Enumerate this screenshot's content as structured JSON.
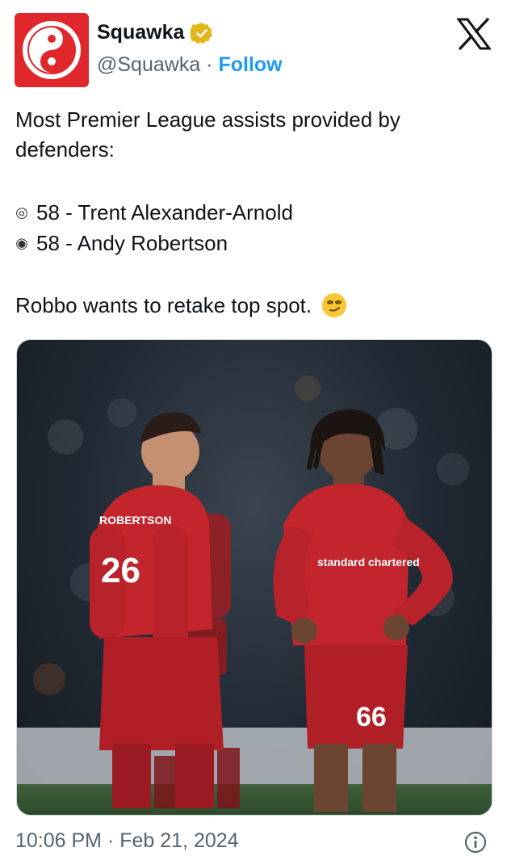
{
  "author": {
    "name": "Squawka",
    "handle": "@Squawka",
    "separator": "·",
    "follow_label": "Follow",
    "brand_color": "#e0272b",
    "verified_badge_color": "#e2b719"
  },
  "tweet": {
    "line1": "Most Premier League assists provided by",
    "line2": "defenders:",
    "list": [
      {
        "bullet": "◎",
        "text": "58 - Trent Alexander-Arnold"
      },
      {
        "bullet": "◉",
        "text": "58 - Andy Robertson"
      }
    ],
    "closing": "Robbo wants to retake top spot.",
    "emoji": "smirking-face-emoji"
  },
  "media": {
    "kit_sponsor": "standard chartered",
    "shirt_numbers": [
      "26",
      "66"
    ],
    "shirt_name": "ROBERTSON"
  },
  "footer": {
    "timestamp": "10:06 PM · Feb 21, 2024"
  },
  "icons": {
    "x_logo": "x-logo-icon",
    "info": "info-icon"
  }
}
